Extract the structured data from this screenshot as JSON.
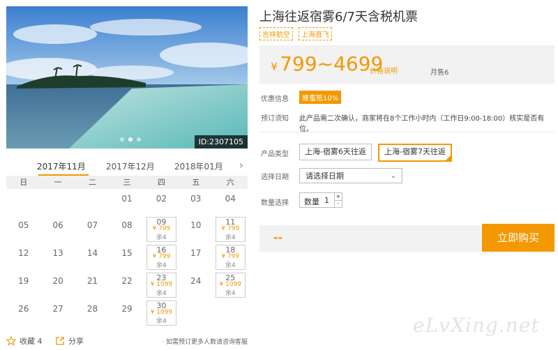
{
  "product": {
    "title": "上海往返宿雾6/7天含税机票",
    "tags": [
      "吉祥航空",
      "上海直飞"
    ],
    "image_id": "ID:2307105",
    "price_range": "799~4699",
    "currency": "¥",
    "price_note": "价格说明",
    "monthly_sales": "月售6"
  },
  "promo": {
    "label": "优惠信息",
    "badge": "蜂蜜抵10%"
  },
  "notice": {
    "label": "预订须知",
    "text": "此产品需二次确认，商家将在8个工作小时内（工作日9:00-18:00）核实是否有位。"
  },
  "options": {
    "type_label": "产品类型",
    "types": [
      "上海-宿雾6天往返",
      "上海-宿雾7天往返"
    ],
    "selected_type": 1,
    "date_label": "选择日期",
    "date_placeholder": "请选择日期",
    "qty_label": "数量选择",
    "qty_prefix": "数量",
    "qty_value": "1",
    "qty_up": "+",
    "qty_down": "-"
  },
  "purchase": {
    "total": "--",
    "buy_label": "立即购买"
  },
  "calendar": {
    "months": [
      "2017年11月",
      "2017年12月",
      "2018年01月"
    ],
    "active_month": 0,
    "next_arrow": "›",
    "weekdays": [
      "日",
      "一",
      "二",
      "三",
      "四",
      "五",
      "六"
    ],
    "weeks": [
      [
        {
          "d": ""
        },
        {
          "d": ""
        },
        {
          "d": ""
        },
        {
          "d": "01"
        },
        {
          "d": "02"
        },
        {
          "d": "03"
        },
        {
          "d": "04"
        }
      ],
      [
        {
          "d": "05"
        },
        {
          "d": "06"
        },
        {
          "d": "07"
        },
        {
          "d": "08"
        },
        {
          "d": "09",
          "p": "¥ 799",
          "r": "余4"
        },
        {
          "d": "10"
        },
        {
          "d": "11",
          "p": "¥ 799",
          "r": "余4"
        }
      ],
      [
        {
          "d": "12"
        },
        {
          "d": "13"
        },
        {
          "d": "14"
        },
        {
          "d": "15"
        },
        {
          "d": "16",
          "p": "¥ 799",
          "r": "余4"
        },
        {
          "d": "17"
        },
        {
          "d": "18",
          "p": "¥ 799",
          "r": "余4"
        }
      ],
      [
        {
          "d": "19"
        },
        {
          "d": "20"
        },
        {
          "d": "21"
        },
        {
          "d": "22"
        },
        {
          "d": "23",
          "p": "¥ 1099",
          "r": "余4"
        },
        {
          "d": "24"
        },
        {
          "d": "25",
          "p": "¥ 1099",
          "r": "余4"
        }
      ],
      [
        {
          "d": "26"
        },
        {
          "d": "27"
        },
        {
          "d": "28"
        },
        {
          "d": "29"
        },
        {
          "d": "30",
          "p": "¥ 1099",
          "r": "余4"
        },
        {
          "d": ""
        },
        {
          "d": ""
        }
      ]
    ]
  },
  "footer": {
    "favorite_label": "收藏 4",
    "share_label": "分享",
    "consult_text": "· 如需预订更多人数请咨询客服"
  },
  "watermark": "eLvXing.net",
  "colors": {
    "accent": "#f39800"
  }
}
